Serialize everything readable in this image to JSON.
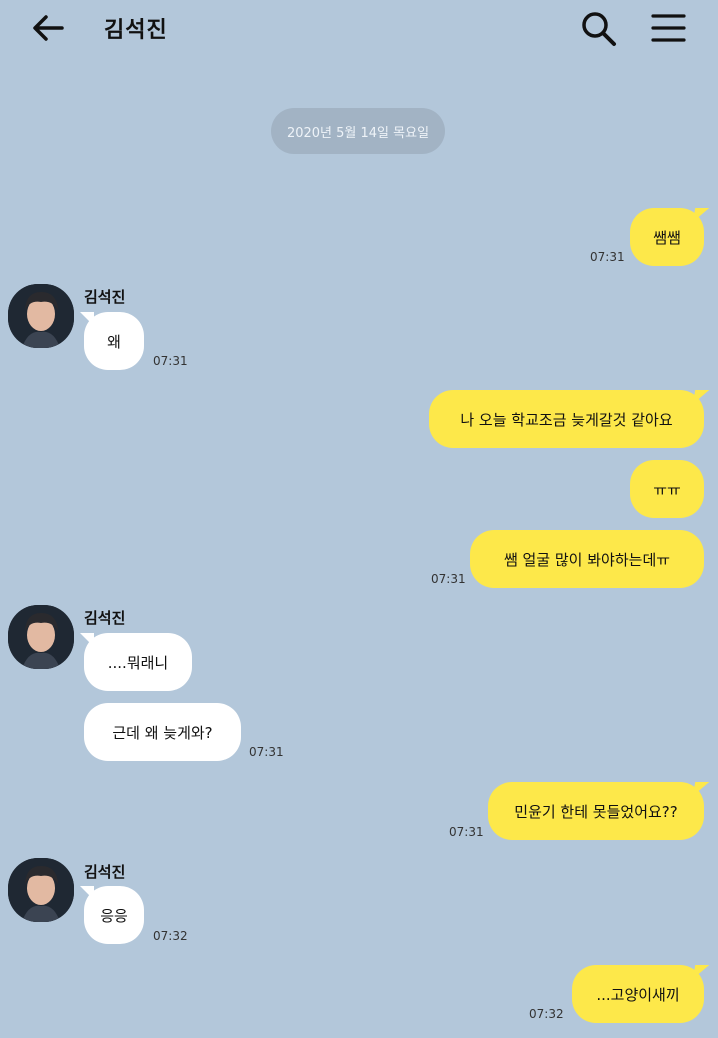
{
  "header": {
    "title": "김석진",
    "back_icon": "arrow-left-icon",
    "search_icon": "search-icon",
    "menu_icon": "hamburger-menu-icon"
  },
  "date_divider": "2020년 5월 14일 목요일",
  "colors": {
    "background": "#b3c7da",
    "my_bubble": "#fde84a",
    "their_bubble": "#ffffff",
    "date_pill": "#a2b3c4"
  },
  "messages": [
    {
      "from": "me",
      "text": "쌤쌤",
      "time": "07:31"
    },
    {
      "from": "them",
      "sender": "김석진",
      "text": "왜",
      "time": "07:31"
    },
    {
      "from": "me",
      "text": "나 오늘 학교조금 늦게갈것 같아요"
    },
    {
      "from": "me",
      "text": "ㅠㅠ"
    },
    {
      "from": "me",
      "text": "쌤 얼굴 많이 봐야하는데ㅠ",
      "time": "07:31"
    },
    {
      "from": "them",
      "sender": "김석진",
      "text": "....뭐래니"
    },
    {
      "from": "them",
      "text": "근데 왜 늦게와?",
      "time": "07:31"
    },
    {
      "from": "me",
      "text": "민윤기 한테 못들었어요??",
      "time": "07:31"
    },
    {
      "from": "them",
      "sender": "김석진",
      "text": "응응",
      "time": "07:32"
    },
    {
      "from": "me",
      "text": "...고양이새끼",
      "time": "07:32"
    }
  ]
}
